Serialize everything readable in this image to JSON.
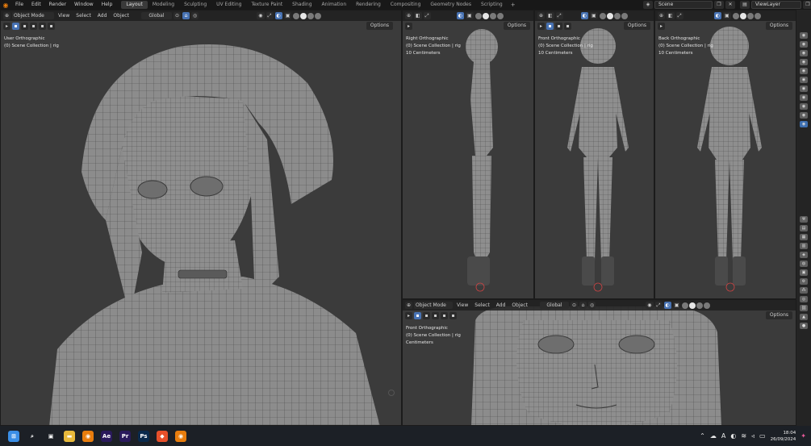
{
  "menu": [
    "File",
    "Edit",
    "Render",
    "Window",
    "Help"
  ],
  "workspaces": {
    "tabs": [
      "Layout",
      "Modeling",
      "Sculpting",
      "UV Editing",
      "Texture Paint",
      "Shading",
      "Animation",
      "Rendering",
      "Compositing",
      "Geometry Nodes",
      "Scripting"
    ],
    "active": "Layout",
    "add": "+"
  },
  "scene": {
    "name": "Scene",
    "view_layer": "ViewLayer"
  },
  "viewport_header": {
    "mode": "Object Mode",
    "menus": [
      "View",
      "Select",
      "Add",
      "Object"
    ],
    "transform": "Global",
    "options": "Options"
  },
  "viewports": {
    "main": {
      "projection": "User Orthographic",
      "collection": "(0) Scene Collection | rig"
    },
    "right": {
      "projection": "Right Orthographic",
      "collection": "(0) Scene Collection | rig",
      "scale": "10 Centimeters"
    },
    "front": {
      "projection": "Front Orthographic",
      "collection": "(0) Scene Collection | rig",
      "scale": "10 Centimeters"
    },
    "back": {
      "projection": "Back Orthographic",
      "collection": "(0) Scene Collection | rig",
      "scale": "10 Centimeters"
    },
    "bottom": {
      "projection": "Front Orthographic",
      "collection": "(0) Scene Collection | rig",
      "scale": "Centimeters"
    }
  },
  "taskbar": {
    "apps": [
      {
        "name": "start-icon",
        "glyph": "⊞",
        "color": "#3a8ee6"
      },
      {
        "name": "search-icon",
        "glyph": "⌕",
        "color": "transparent"
      },
      {
        "name": "task-view-icon",
        "glyph": "▣",
        "color": "transparent"
      },
      {
        "name": "file-explorer-icon",
        "glyph": "▬",
        "color": "#e8b93b"
      },
      {
        "name": "blender-app-icon",
        "glyph": "◉",
        "color": "#e87d0d"
      },
      {
        "name": "after-effects-icon",
        "glyph": "Ae",
        "color": "#2a1a5c"
      },
      {
        "name": "premiere-icon",
        "glyph": "Pr",
        "color": "#2a1a5c"
      },
      {
        "name": "photoshop-icon",
        "glyph": "Ps",
        "color": "#0a2a4c"
      },
      {
        "name": "brave-icon",
        "glyph": "◆",
        "color": "#e8502a"
      },
      {
        "name": "blender-app-icon-2",
        "glyph": "◉",
        "color": "#e87d0d"
      }
    ],
    "time": "18:04",
    "date": "26/09/2024"
  },
  "colors": {
    "accent": "#4772b3",
    "viewport_bg": "#3b3b3b",
    "header_bg": "#181818"
  }
}
